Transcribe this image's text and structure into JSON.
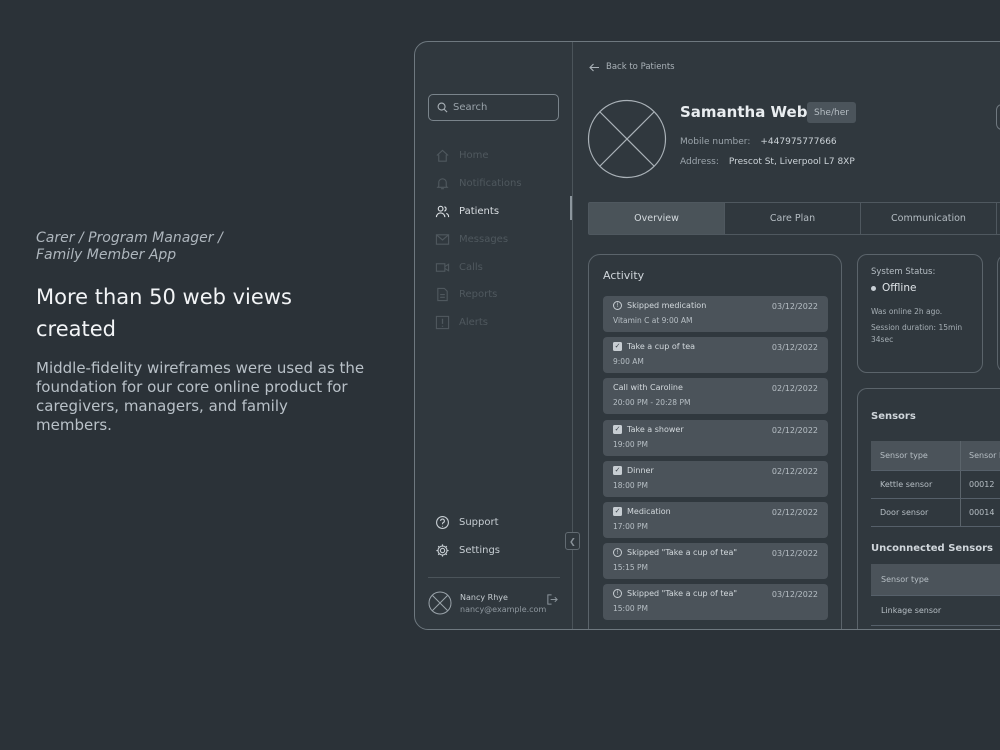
{
  "promo": {
    "kicker": "Carer / Program Manager / Family Member App",
    "headline": "More than 50 web views created",
    "description": "Middle-fidelity wireframes were used as the foundation for our core online product for caregivers, managers, and family members."
  },
  "sidebar": {
    "search_placeholder": "Search",
    "items": [
      {
        "label": "Home",
        "icon": "home-icon"
      },
      {
        "label": "Notifications",
        "icon": "bell-icon"
      },
      {
        "label": "Patients",
        "icon": "users-icon",
        "active": true
      },
      {
        "label": "Messages",
        "icon": "mail-icon"
      },
      {
        "label": "Calls",
        "icon": "video-icon"
      },
      {
        "label": "Reports",
        "icon": "document-icon"
      },
      {
        "label": "Alerts",
        "icon": "alert-icon"
      }
    ],
    "bottom_items": [
      {
        "label": "Support",
        "icon": "help-icon"
      },
      {
        "label": "Settings",
        "icon": "gear-icon"
      }
    ],
    "user": {
      "name": "Nancy Rhye",
      "email": "nancy@example.com"
    }
  },
  "patient": {
    "back_label": "Back to Patients",
    "name": "Samantha Webb",
    "pronouns": "She/her",
    "mobile_label": "Mobile number:",
    "mobile": "+447975777666",
    "address_label": "Address:",
    "address": "Prescot St, Liverpool L7 8XP"
  },
  "tabs": [
    "Overview",
    "Care Plan",
    "Communication"
  ],
  "activity": {
    "title": "Activity",
    "items": [
      {
        "title": "Skipped medication",
        "subtitle": "Vitamin C at 9:00 AM",
        "date": "03/12/2022",
        "icon": "warning"
      },
      {
        "title": "Take a cup of tea",
        "subtitle": "9:00 AM",
        "date": "03/12/2022",
        "icon": "check"
      },
      {
        "title": "Call with Caroline",
        "subtitle": "20:00 PM - 20:28 PM",
        "date": "02/12/2022",
        "icon": "none"
      },
      {
        "title": "Take a shower",
        "subtitle": "19:00 PM",
        "date": "02/12/2022",
        "icon": "check"
      },
      {
        "title": "Dinner",
        "subtitle": "18:00 PM",
        "date": "02/12/2022",
        "icon": "check"
      },
      {
        "title": "Medication",
        "subtitle": "17:00 PM",
        "date": "02/12/2022",
        "icon": "check"
      },
      {
        "title": "Skipped \"Take a cup of tea\"",
        "subtitle": "15:15 PM",
        "date": "03/12/2022",
        "icon": "warning"
      },
      {
        "title": "Skipped \"Take a cup of tea\"",
        "subtitle": "15:00 PM",
        "date": "03/12/2022",
        "icon": "warning"
      }
    ]
  },
  "system_status": {
    "label": "System Status:",
    "value": "Offline",
    "last_online": "Was online 2h ago.",
    "session": "Session duration: 15min 34sec"
  },
  "sensors": {
    "title": "Sensors",
    "headers": [
      "Sensor type",
      "Sensor I"
    ],
    "rows": [
      [
        "Kettle sensor",
        "00012"
      ],
      [
        "Door sensor",
        "00014"
      ]
    ],
    "unconnected_title": "Unconnected Sensors",
    "unconnected_header": "Sensor type",
    "unconnected_rows": [
      "Linkage sensor"
    ]
  }
}
